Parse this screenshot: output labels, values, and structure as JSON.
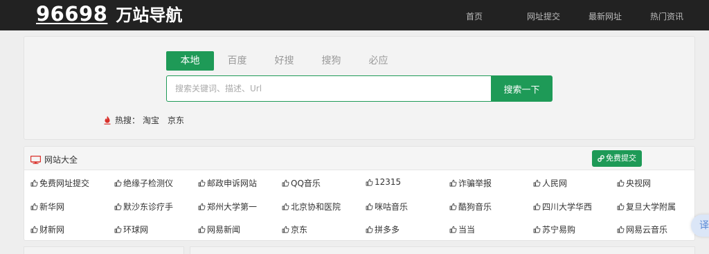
{
  "header": {
    "logo_number": "96698",
    "logo_text": "万站导航",
    "nav": [
      "首页",
      "网址提交",
      "最新网址",
      "热门资讯"
    ]
  },
  "search": {
    "tabs": [
      "本地",
      "百度",
      "好搜",
      "搜狗",
      "必应"
    ],
    "active_tab": "本地",
    "placeholder": "搜索关键词、描述、Url",
    "value": "",
    "button_label": "搜索一下",
    "hot_label": "热搜：",
    "hot_links": [
      "淘宝",
      "京东"
    ]
  },
  "sites": {
    "title": "网站大全",
    "submit_label": "免费提交",
    "rows": [
      [
        "免费网址提交",
        "绝缘子检测仪",
        "邮政申诉网站",
        "QQ音乐",
        "12315",
        "诈骗举报",
        "人民网",
        "央视网"
      ],
      [
        "新华网",
        "默沙东诊疗手",
        "郑州大学第一",
        "北京协和医院",
        "咪咕音乐",
        "酷狗音乐",
        "四川大学华西",
        "复旦大学附属"
      ],
      [
        "财新网",
        "环球网",
        "网易新闻",
        "京东",
        "拼多多",
        "当当",
        "苏宁易购",
        "网易云音乐"
      ]
    ]
  },
  "translate_label": "译",
  "colors": {
    "topbar": "#222222",
    "accent_green": "#1e9a57",
    "hot_red": "#d9302a",
    "monitor_red": "#d9302a"
  },
  "icons": {
    "hot": "flame-icon",
    "section": "monitor-icon",
    "submit": "link-icon",
    "site": "thumbs-up-icon"
  }
}
